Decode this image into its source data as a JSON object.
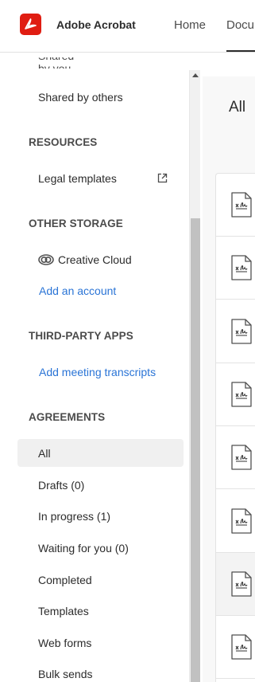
{
  "header": {
    "app_title": "Adobe Acrobat",
    "nav": [
      {
        "label": "Home"
      },
      {
        "label": "Documents"
      }
    ],
    "brand_color": "#e01d12"
  },
  "sidebar": {
    "partial_item": "Shared by you",
    "shared_by_others": "Shared by others",
    "resources_heading": "RESOURCES",
    "legal_templates": "Legal templates",
    "other_storage_heading": "OTHER STORAGE",
    "creative_cloud": "Creative Cloud",
    "add_account": "Add an account",
    "third_party_heading": "THIRD-PARTY APPS",
    "add_meeting_transcripts": "Add meeting transcripts",
    "agreements_heading": "AGREEMENTS",
    "agreements": [
      {
        "label": "All",
        "selected": true
      },
      {
        "label": "Drafts (0)"
      },
      {
        "label": "In progress (1)"
      },
      {
        "label": "Waiting for you (0)"
      },
      {
        "label": "Completed"
      },
      {
        "label": "Templates"
      },
      {
        "label": "Web forms"
      },
      {
        "label": "Bulk sends"
      }
    ],
    "link_color": "#2a74d6"
  },
  "main": {
    "title": "All",
    "rows": [
      {
        "icon": "signature-document-icon"
      },
      {
        "icon": "signature-document-icon"
      },
      {
        "icon": "signature-document-icon"
      },
      {
        "icon": "signature-document-icon"
      },
      {
        "icon": "signature-document-icon"
      },
      {
        "icon": "signature-document-icon"
      },
      {
        "icon": "signature-document-icon",
        "highlighted": true
      },
      {
        "icon": "signature-document-icon"
      }
    ]
  }
}
